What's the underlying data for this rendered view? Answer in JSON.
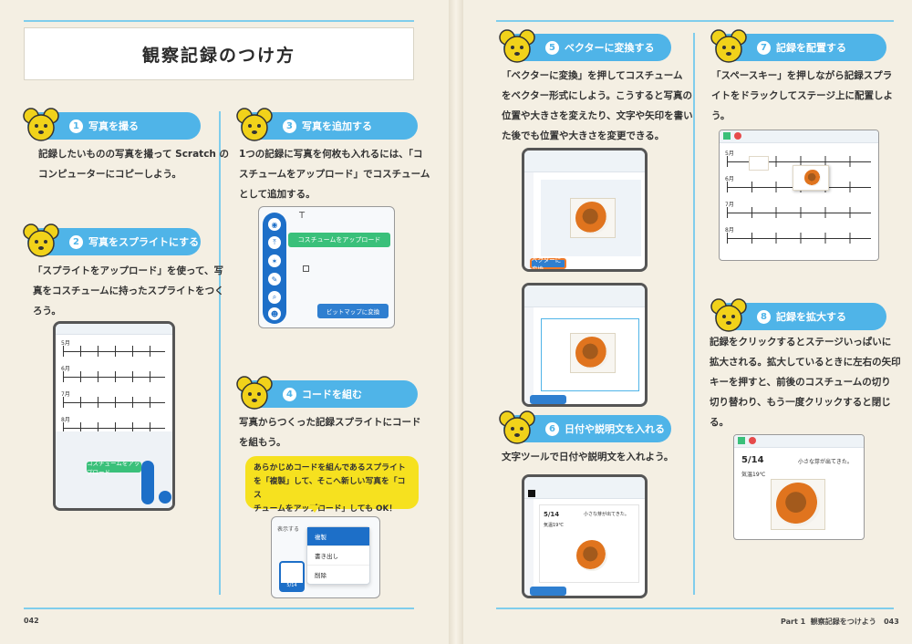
{
  "left_page": {
    "title": "観察記録のつけ方",
    "page_number": "042",
    "steps": [
      {
        "num": "1",
        "heading": "写真を撮る",
        "text": [
          "記録したいものの写真を撮って Scratch の",
          "コンピューターにコピーしよう。"
        ]
      },
      {
        "num": "2",
        "heading": "写真をスプライトにする",
        "text": [
          "「スプライトをアップロード」を使って、写",
          "真をコスチュームに持ったスプライトをつく",
          "ろう。"
        ]
      },
      {
        "num": "3",
        "heading": "写真を追加する",
        "text": [
          "1つの記録に写真を何枚も入れるには、「コ",
          "スチュームをアップロード」でコスチューム",
          "として追加する。"
        ]
      },
      {
        "num": "4",
        "heading": "コードを組む",
        "text": [
          "写真からつくった記録スプライトにコード",
          "を組もう。"
        ]
      }
    ],
    "tooltip": "コスチュームをアップロード",
    "bitmap_button": "ビットマップに変換",
    "calendar_months": [
      "5月",
      "6月",
      "7月",
      "8月"
    ],
    "costume_tab_button": "コスチュームをアップロード",
    "speech_bubble": [
      "あらかじめコードを組んであるスプライト",
      "を「複製」して、そこへ新しい写真を「コス",
      "チュームをアップロード」しても OK！"
    ],
    "context_menu": [
      "複製",
      "書き出し",
      "削除"
    ],
    "menu_header": "表示する",
    "sprite_label": "5/14"
  },
  "right_page": {
    "footer_part": "Part 1",
    "footer_title": "観察記録をつけよう",
    "page_number": "043",
    "steps": [
      {
        "num": "5",
        "heading": "ベクターに変換する",
        "text": [
          "「ベクターに変換」を押してコスチューム",
          "をベクター形式にしよう。こうすると写真の",
          "位置や大きさを変えたり、文字や矢印を書い",
          "た後でも位置や大きさを変更できる。"
        ]
      },
      {
        "num": "6",
        "heading": "日付や説明文を入れる",
        "text": [
          "文字ツールで日付や説明文を入れよう。"
        ]
      },
      {
        "num": "7",
        "heading": "記録を配置する",
        "text": [
          "「スペースキー」を押しながら記録スプラ",
          "イトをドラックしてステージ上に配置しよ",
          "う。"
        ]
      },
      {
        "num": "8",
        "heading": "記録を拡大する",
        "text": [
          "記録をクリックするとステージいっぱいに",
          "拡大される。拡大しているときに左右の矢印",
          "キーを押すと、前後のコスチュームの切り",
          "切り替わり、もう一度クリックすると閉じ",
          "る。"
        ]
      }
    ],
    "vector_button": "ベクターに変換",
    "calendar_months": [
      "5月",
      "6月",
      "7月",
      "8月"
    ],
    "note_date": "5/14",
    "note_temp": "気温19℃",
    "note_caption": "小さな芽が出てきた。"
  },
  "colors": {
    "accent": "#4fb4e8",
    "rule": "#7fcdec",
    "paper": "#f4efe3",
    "bubble": "#f6e11f",
    "scratch_blue": "#1d6fc8"
  }
}
